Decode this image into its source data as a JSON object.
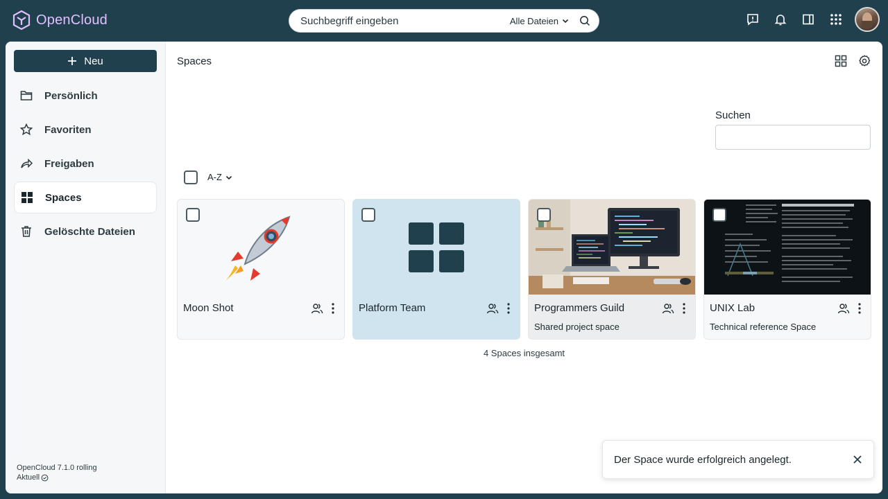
{
  "app": {
    "name": "OpenCloud"
  },
  "search": {
    "placeholder": "Suchbegriff eingeben",
    "scope": "Alle Dateien"
  },
  "sidebar": {
    "new_label": "Neu",
    "items": [
      {
        "label": "Persönlich",
        "icon": "folder-icon"
      },
      {
        "label": "Favoriten",
        "icon": "star-icon"
      },
      {
        "label": "Freigaben",
        "icon": "share-icon"
      },
      {
        "label": "Spaces",
        "icon": "spaces-grid-icon",
        "active": true
      },
      {
        "label": "Gelöschte Dateien",
        "icon": "trash-icon"
      }
    ],
    "version": "OpenCloud 7.1.0 rolling",
    "status": "Aktuell"
  },
  "main": {
    "breadcrumb": "Spaces",
    "filter_label": "Suchen",
    "sort_label": "A-Z",
    "total": "4 Spaces insgesamt"
  },
  "cards": [
    {
      "title": "Moon Shot",
      "description": "",
      "image": "rocket-emoji"
    },
    {
      "title": "Platform Team",
      "description": "",
      "image": "spaces-grid-icon"
    },
    {
      "title": "Programmers Guild",
      "description": "Shared project space",
      "image": "desk-photo"
    },
    {
      "title": "UNIX Lab",
      "description": "Technical reference Space",
      "image": "terminal-screenshot"
    }
  ],
  "toast": {
    "message": "Der Space wurde erfolgreich angelegt."
  },
  "colors": {
    "topbar": "#20404d",
    "brand": "#e0c0ff",
    "selected_card": "#cfe4ef"
  }
}
